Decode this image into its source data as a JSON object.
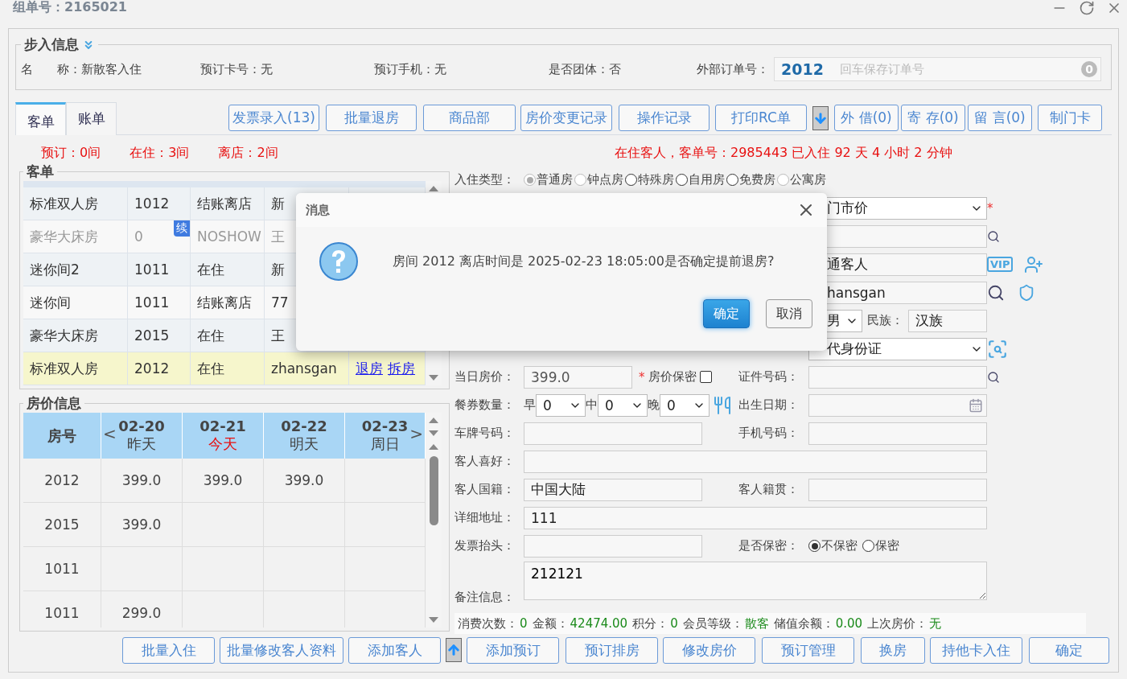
{
  "header": {
    "group_label": "组单号：2165021"
  },
  "walkin": {
    "legend": "步入信息",
    "fields": [
      {
        "label": "名　　称：",
        "value": "新散客入住"
      },
      {
        "label": "预订卡号：",
        "value": "无"
      },
      {
        "label": "预订手机：",
        "value": "无"
      },
      {
        "label": "是否团体：",
        "value": "否"
      }
    ],
    "external_order": {
      "label": "外部订单号：",
      "value": "2012",
      "placeholder": "回车保存订单号",
      "count": "0"
    }
  },
  "tabs": [
    {
      "label": "客单",
      "selected": true
    },
    {
      "label": "账单",
      "selected": false
    }
  ],
  "toolbar": [
    {
      "kind": "button",
      "label": "发票录入(13)"
    },
    {
      "kind": "button",
      "label": "批量退房"
    },
    {
      "kind": "button",
      "label": "商品部"
    },
    {
      "kind": "button",
      "label": "房价变更记录"
    },
    {
      "kind": "button",
      "label": "操作记录"
    },
    {
      "kind": "button",
      "label": "打印RC单"
    },
    {
      "kind": "arrow"
    },
    {
      "kind": "button",
      "label": "外 借(0)"
    },
    {
      "kind": "button",
      "label": "寄 存(0)"
    },
    {
      "kind": "button",
      "label": "留 言(0)"
    },
    {
      "kind": "button",
      "label": "制门卡"
    }
  ],
  "summary": [
    "预订：0间",
    "在住：3间",
    "离店：2间"
  ],
  "status": "在住客人，客单号：2985443 已入住 92 天 4 小时 2 分钟",
  "guest_table": {
    "legend": "客单",
    "rows": [
      {
        "cells": [
          "标准双人房",
          "1012",
          "结账离店",
          "新"
        ],
        "greyed": false,
        "selected": false
      },
      {
        "cells": [
          "豪华大床房",
          "0",
          "NOSHOW",
          "王"
        ],
        "badge": "续",
        "greyed": true,
        "selected": false
      },
      {
        "cells": [
          "迷你间2",
          "1011",
          "在住",
          "新"
        ],
        "greyed": false,
        "selected": false
      },
      {
        "cells": [
          "迷你间",
          "1011",
          "结账离店",
          "77"
        ],
        "greyed": false,
        "selected": false
      },
      {
        "cells": [
          "豪华大床房",
          "2015",
          "在住",
          "王"
        ],
        "greyed": false,
        "selected": false
      },
      {
        "cells": [
          "标准双人房",
          "2012",
          "在住",
          "zhansgan"
        ],
        "links": [
          "退房",
          "拆房"
        ],
        "greyed": false,
        "selected": true
      }
    ]
  },
  "price_table": {
    "legend": "房价信息",
    "room_header": "房号",
    "prev": "<",
    "next": ">",
    "dates": [
      {
        "date": "02-20",
        "day": "昨天",
        "today": false
      },
      {
        "date": "02-21",
        "day": "今天",
        "today": true
      },
      {
        "date": "02-22",
        "day": "明天",
        "today": false
      },
      {
        "date": "02-23",
        "day": "周日",
        "today": false
      }
    ],
    "rows": [
      {
        "room": "2012",
        "prices": [
          "399.0",
          "399.0",
          "399.0"
        ]
      },
      {
        "room": "2015",
        "prices": [
          "399.0"
        ]
      },
      {
        "room": "1011"
      },
      {
        "room": "1011",
        "prices": [
          "299.0"
        ]
      }
    ]
  },
  "form": {
    "checkin_type": {
      "label": "入住类型：",
      "options": [
        {
          "label": "普通房",
          "selected": true,
          "disabled": true
        },
        {
          "label": "钟点房",
          "selected": false,
          "disabled": true
        },
        {
          "label": "特殊房",
          "selected": false,
          "disabled": false
        },
        {
          "label": "自用房",
          "selected": false,
          "disabled": false
        },
        {
          "label": "免费房",
          "selected": false,
          "disabled": false
        },
        {
          "label": "公寓房",
          "selected": false,
          "disabled": true
        }
      ]
    },
    "price_scheme": {
      "value": "门市价",
      "required": "*"
    },
    "guest_type": {
      "value": "通客人",
      "vip": "VIP"
    },
    "guest_name": {
      "value": "hansgan"
    },
    "gender": {
      "value": "男"
    },
    "ethnicity": {
      "label": "民族：",
      "value": "汉族"
    },
    "id_type": {
      "value": "代身份证"
    },
    "room_price": {
      "label": "当日房价：",
      "value": "399.0",
      "required": "*",
      "secret_label": "房价保密",
      "secret_checked": false
    },
    "id_number": {
      "label": "证件号码："
    },
    "meals": {
      "label": "餐券数量：",
      "items": [
        {
          "label": "早",
          "value": "0"
        },
        {
          "label": "中",
          "value": "0"
        },
        {
          "label": "晚",
          "value": "0"
        }
      ]
    },
    "birth": {
      "label": "出生日期："
    },
    "plate": {
      "label": "车牌号码："
    },
    "phone": {
      "label": "手机号码："
    },
    "preference": {
      "label": "客人喜好："
    },
    "nationality": {
      "label": "客人国籍：",
      "value": "中国大陆"
    },
    "origin": {
      "label": "客人籍贯："
    },
    "address": {
      "label": "详细地址：",
      "value": "111"
    },
    "invoice": {
      "label": "发票抬头："
    },
    "privacy": {
      "label": "是否保密：",
      "options": [
        {
          "label": "不保密",
          "selected": true
        },
        {
          "label": "保密",
          "selected": false
        }
      ]
    },
    "remark": {
      "label": "备注信息：",
      "value": "212121"
    }
  },
  "stats": [
    {
      "label": "消费次数：",
      "value": "0"
    },
    {
      "label": "金额：",
      "value": "42474.00"
    },
    {
      "label": "积分：",
      "value": "0"
    },
    {
      "label": "会员等级：",
      "value": "散客"
    },
    {
      "label": "储值余额：",
      "value": "0.00"
    },
    {
      "label": "上次房价：",
      "value": "无"
    }
  ],
  "bottom_buttons": [
    {
      "kind": "button",
      "label": "批量入住"
    },
    {
      "kind": "button",
      "label": "批量修改客人资料"
    },
    {
      "kind": "button",
      "label": "添加客人"
    },
    {
      "kind": "arrow"
    },
    {
      "kind": "button",
      "label": "添加预订"
    },
    {
      "kind": "button",
      "label": "预订排房"
    },
    {
      "kind": "button",
      "label": "修改房价"
    },
    {
      "kind": "button",
      "label": "预订管理"
    },
    {
      "kind": "button",
      "label": "换房"
    },
    {
      "kind": "button",
      "label": "持他卡入住"
    },
    {
      "kind": "button",
      "label": "确定"
    }
  ],
  "dialog": {
    "title": "消息",
    "message": "房间 2012 离店时间是 2025-02-23 18:05:00是否确定提前退房?",
    "buttons": [
      {
        "label": "确定",
        "primary": true
      },
      {
        "label": "取消",
        "primary": false
      }
    ]
  }
}
